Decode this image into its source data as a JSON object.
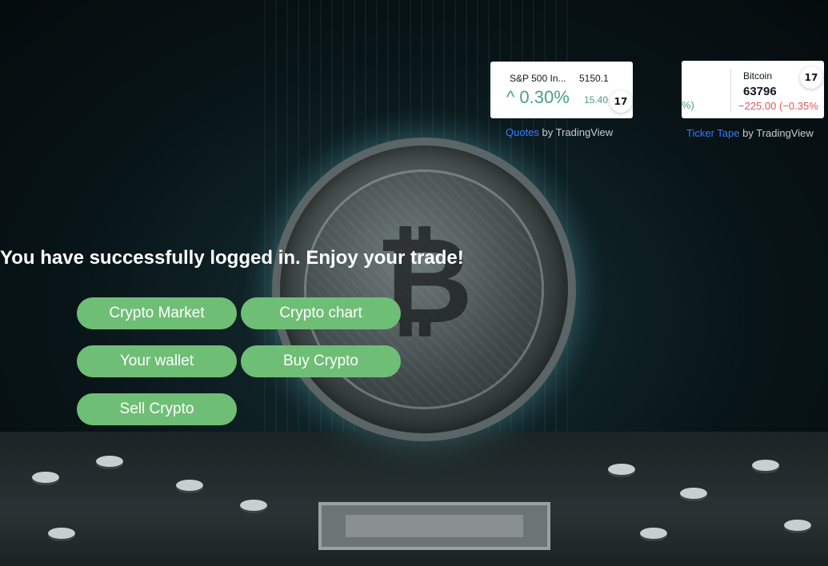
{
  "message": "You have successfully logged in. Enjoy your trade!",
  "buttons": {
    "crypto_market": "Crypto Market",
    "crypto_chart": "Crypto chart",
    "your_wallet": "Your wallet",
    "buy_crypto": "Buy Crypto",
    "sell_crypto": "Sell Crypto"
  },
  "quotes_widget": {
    "symbol_name": "S&P 500 In...",
    "price": "5150.1",
    "percent_change": "^ 0.30%",
    "change": "15.40",
    "attribution_link": "Quotes",
    "attribution_suffix": " by TradingView",
    "logo_text": "17"
  },
  "ticker_widget": {
    "edge_text": "%)",
    "symbol_name": "Bitcoin",
    "price": "63796",
    "change": "−225.00 (−0.35%",
    "attribution_link": "Ticker Tape",
    "attribution_suffix": " by TradingView",
    "logo_text": "17"
  },
  "colors": {
    "button": "#6fbe76",
    "positive": "#4a9e82",
    "negative": "#e35555",
    "link": "#3b7bff"
  },
  "icons": {
    "tradingview_logo": "tradingview-logo-icon",
    "background": "bitcoin-coin-circuit-background"
  }
}
